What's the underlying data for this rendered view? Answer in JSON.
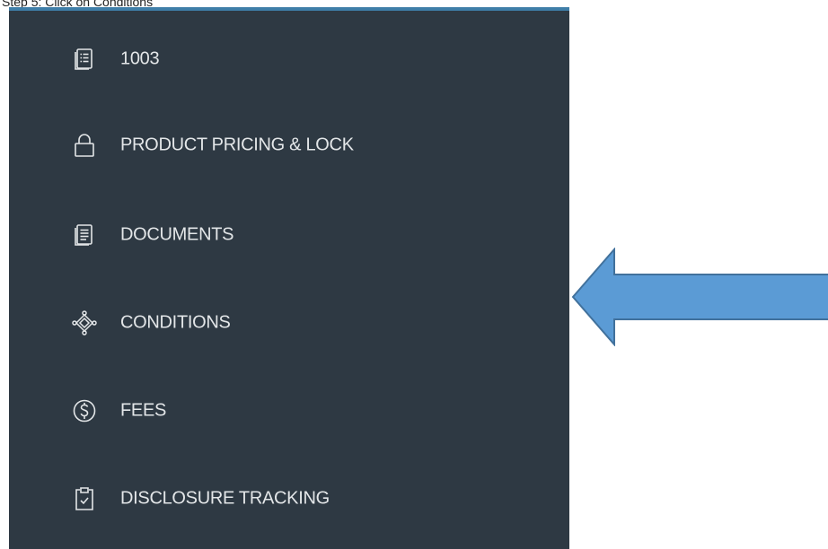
{
  "header": {
    "cropped_text": "Step 5: Click on Conditions"
  },
  "sidebar": {
    "items": [
      {
        "label": "1003",
        "icon": "form-list-icon"
      },
      {
        "label": "PRODUCT PRICING & LOCK",
        "icon": "lock-icon"
      },
      {
        "label": "DOCUMENTS",
        "icon": "document-icon"
      },
      {
        "label": "CONDITIONS",
        "icon": "conditions-diamond-icon"
      },
      {
        "label": "FEES",
        "icon": "dollar-circle-icon"
      },
      {
        "label": "DISCLOSURE TRACKING",
        "icon": "clipboard-check-icon"
      }
    ]
  },
  "colors": {
    "sidebar_bg": "#2e3943",
    "sidebar_text": "#e3e6e8",
    "accent_top": "#3f7ea8",
    "callout_arrow_fill": "#5b9bd5",
    "callout_arrow_stroke": "#41719c"
  }
}
